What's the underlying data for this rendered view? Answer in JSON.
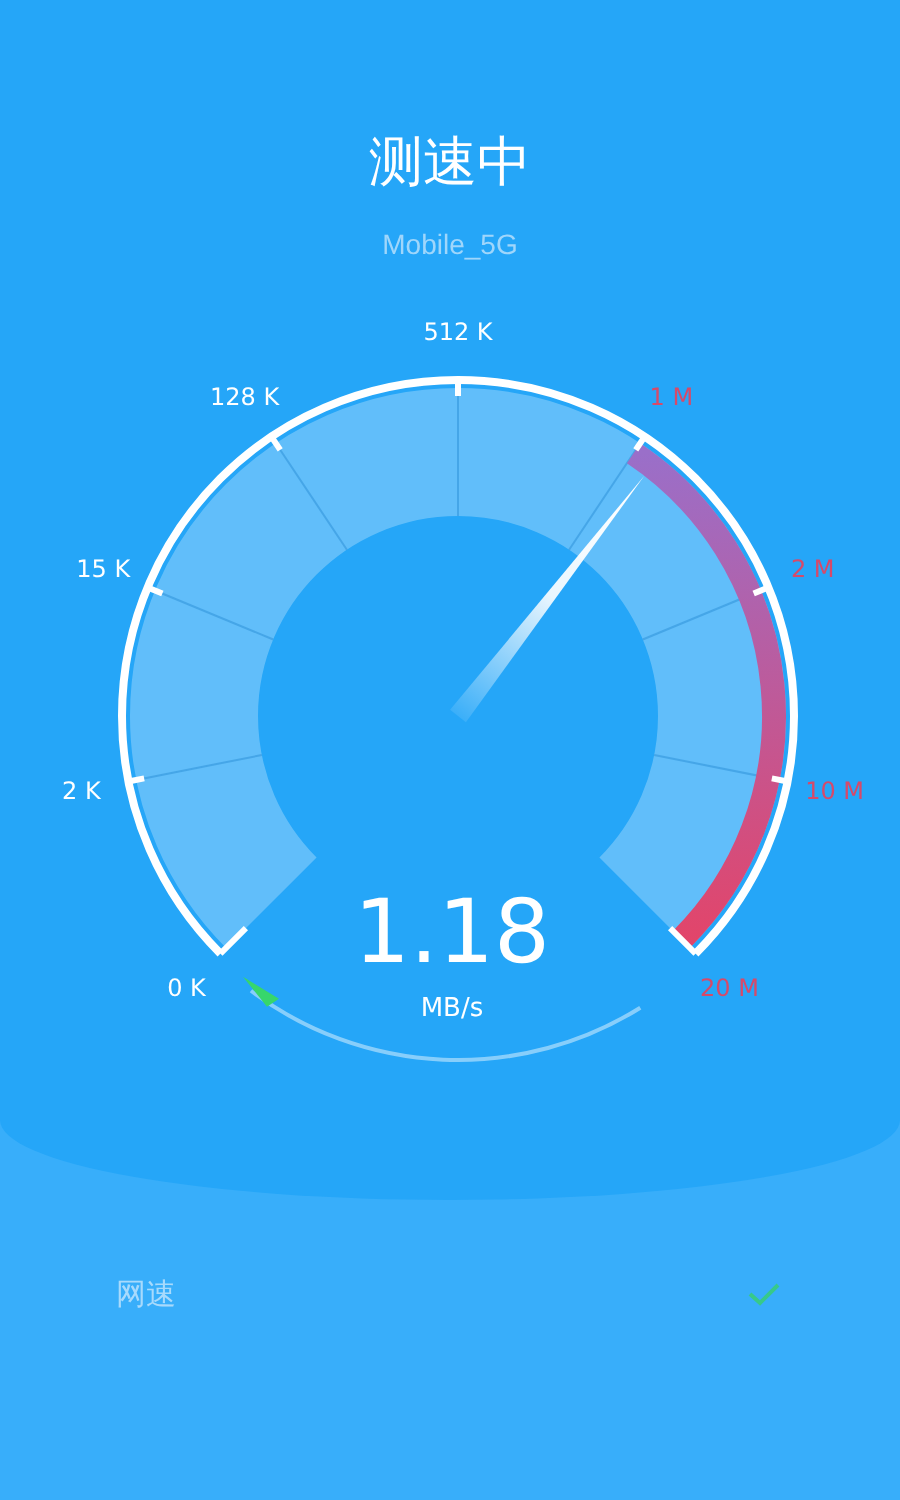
{
  "header": {
    "title": "测速中",
    "network": "Mobile_5G"
  },
  "gauge": {
    "ticks": [
      {
        "label": "0 K",
        "highlighted": false
      },
      {
        "label": "2 K",
        "highlighted": false
      },
      {
        "label": "15 K",
        "highlighted": false
      },
      {
        "label": "128 K",
        "highlighted": false
      },
      {
        "label": "512 K",
        "highlighted": false
      },
      {
        "label": "1 M",
        "highlighted": true
      },
      {
        "label": "2 M",
        "highlighted": true
      },
      {
        "label": "10 M",
        "highlighted": true
      },
      {
        "label": "20 M",
        "highlighted": true
      }
    ],
    "needle": {
      "level": 0.64
    },
    "reading": "1.18",
    "unit": "MB/s"
  },
  "results": [
    {
      "label": "网速",
      "checked": true
    }
  ]
}
